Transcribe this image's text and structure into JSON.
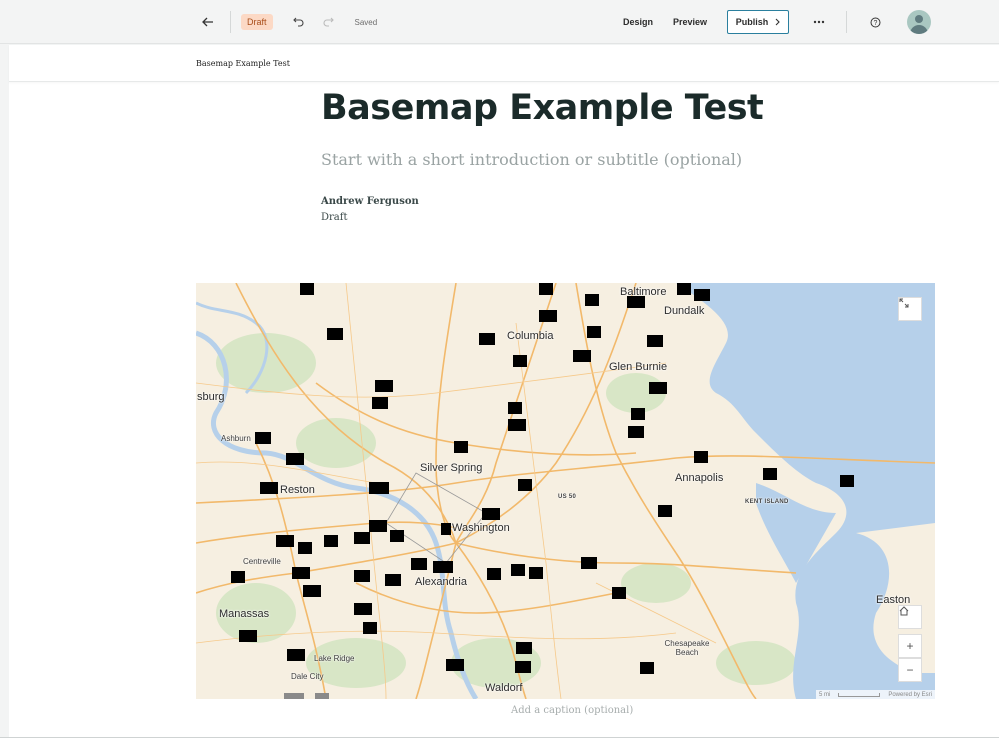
{
  "topbar": {
    "back_icon": "back-arrow-icon",
    "status_badge": "Draft",
    "undo_icon": "undo-icon",
    "redo_icon": "redo-icon",
    "saved_label": "Saved",
    "design_label": "Design",
    "preview_label": "Preview",
    "publish_label": "Publish",
    "more_icon": "more-icon",
    "help_icon": "help-icon",
    "avatar_icon": "avatar-icon"
  },
  "subheader": {
    "breadcrumb": "Basemap Example Test"
  },
  "story": {
    "title": "Basemap Example Test",
    "subtitle_placeholder": "Start with a short introduction or subtitle (optional)",
    "author": "Andrew Ferguson",
    "status": "Draft"
  },
  "map": {
    "labels": [
      "Baltimore",
      "Dundalk",
      "Columbia",
      "Glen Burnie",
      "sburg",
      "Ashburn",
      "Silver Spring",
      "Reston",
      "Annapolis",
      "KENT ISLAND",
      "US 50",
      "Washington",
      "Centreville",
      "Alexandria",
      "Manassas",
      "Easton",
      "Chesapeake Beach",
      "Lake Ridge",
      "Dale City",
      "Waldorf"
    ],
    "controls": {
      "expand_icon": "expand-icon",
      "home_icon": "home-icon",
      "zoom_in": "+",
      "zoom_out": "−"
    },
    "scale": "5 mi",
    "attribution": "Powered by Esri"
  },
  "caption_placeholder": "Add a caption (optional)",
  "colors": {
    "water": "#b6d0ea",
    "land": "#f6efe1",
    "park": "#d4e4c4",
    "road": "#f2b96b",
    "publish_border": "#2a7f9e",
    "badge_bg": "#fcd9c5"
  }
}
